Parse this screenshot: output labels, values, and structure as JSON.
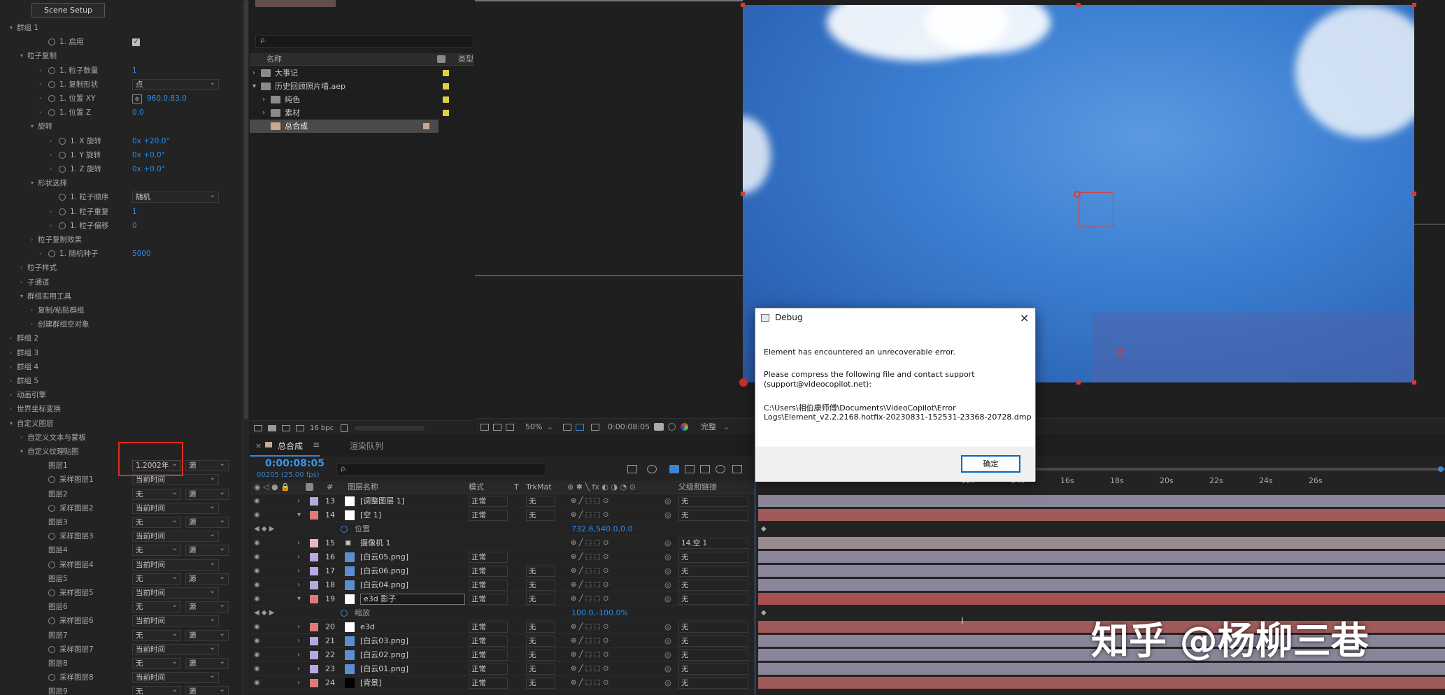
{
  "effect_panel": {
    "scene_setup": "Scene Setup",
    "rows": [
      {
        "t": "群组 1",
        "lv": 0,
        "arrow": "v"
      },
      {
        "t": "1. 启用",
        "lv": 3,
        "sw": 1,
        "chk": true
      },
      {
        "t": "粒子复制",
        "lv": 1,
        "arrow": "v"
      },
      {
        "t": "1. 粒子数量",
        "lv": 3,
        "sw": 1,
        "arrow": ">",
        "val": "1"
      },
      {
        "t": "1. 复制形状",
        "lv": 3,
        "sw": 1,
        "arrow": ">",
        "dd": "点"
      },
      {
        "t": "1. 位置 XY",
        "lv": 3,
        "sw": 1,
        "arrow": ">",
        "val": "960.0,83.0",
        "xy": true
      },
      {
        "t": "1. 位置 Z",
        "lv": 3,
        "sw": 1,
        "arrow": ">",
        "val": "0.0"
      },
      {
        "t": "旋转",
        "lv": 2,
        "arrow": "v"
      },
      {
        "t": "1. X 旋转",
        "lv": 4,
        "sw": 1,
        "arrow": ">",
        "val": "0x +20.0°"
      },
      {
        "t": "1. Y 旋转",
        "lv": 4,
        "sw": 1,
        "arrow": ">",
        "val": "0x +0.0°"
      },
      {
        "t": "1. Z 旋转",
        "lv": 4,
        "sw": 1,
        "arrow": ">",
        "val": "0x +0.0°"
      },
      {
        "t": "形状选择",
        "lv": 2,
        "arrow": "v"
      },
      {
        "t": "1. 粒子顺序",
        "lv": 4,
        "sw": 1,
        "dd": "随机"
      },
      {
        "t": "1. 粒子重复",
        "lv": 4,
        "sw": 1,
        "arrow": ">",
        "val": "1"
      },
      {
        "t": "1. 粒子偏移",
        "lv": 4,
        "sw": 1,
        "arrow": ">",
        "val": "0"
      },
      {
        "t": "粒子复制效果",
        "lv": 2,
        "arrow": ">"
      },
      {
        "t": "1. 随机种子",
        "lv": 3,
        "sw": 1,
        "arrow": ">",
        "val": "5000"
      },
      {
        "t": "粒子样式",
        "lv": 1,
        "arrow": ">"
      },
      {
        "t": "子通道",
        "lv": 1,
        "arrow": ">"
      },
      {
        "t": "群组实用工具",
        "lv": 1,
        "arrow": "v"
      },
      {
        "t": "复制/粘贴群组",
        "lv": 2,
        "arrow": ">"
      },
      {
        "t": "创建群组空对象",
        "lv": 2,
        "arrow": ">"
      },
      {
        "t": "群组 2",
        "lv": 0,
        "arrow": ">"
      },
      {
        "t": "群组 3",
        "lv": 0,
        "arrow": ">"
      },
      {
        "t": "群组 4",
        "lv": 0,
        "arrow": ">"
      },
      {
        "t": "群组 5",
        "lv": 0,
        "arrow": ">"
      },
      {
        "t": "动画引擎",
        "lv": 0,
        "arrow": ">"
      },
      {
        "t": "世界坐标变换",
        "lv": 0,
        "arrow": ">"
      },
      {
        "t": "自定义图层",
        "lv": 0,
        "arrow": "v"
      },
      {
        "t": "自定义文本与蒙板",
        "lv": 1,
        "arrow": ">"
      },
      {
        "t": "自定义纹理贴图",
        "lv": 1,
        "arrow": "v"
      },
      {
        "t": "图层1",
        "lv": 3,
        "dd": "1.2002年",
        "dd2": "源"
      },
      {
        "t": "采样图层1",
        "lv": 3,
        "sw": 1,
        "dd": "当前时间"
      },
      {
        "t": "图层2",
        "lv": 3,
        "dd": "无",
        "dd2": "源"
      },
      {
        "t": "采样图层2",
        "lv": 3,
        "sw": 1,
        "dd": "当前时间"
      },
      {
        "t": "图层3",
        "lv": 3,
        "dd": "无",
        "dd2": "源"
      },
      {
        "t": "采样图层3",
        "lv": 3,
        "sw": 1,
        "dd": "当前时间"
      },
      {
        "t": "图层4",
        "lv": 3,
        "dd": "无",
        "dd2": "源"
      },
      {
        "t": "采样图层4",
        "lv": 3,
        "sw": 1,
        "dd": "当前时间"
      },
      {
        "t": "图层5",
        "lv": 3,
        "dd": "无",
        "dd2": "源"
      },
      {
        "t": "采样图层5",
        "lv": 3,
        "sw": 1,
        "dd": "当前时间"
      },
      {
        "t": "图层6",
        "lv": 3,
        "dd": "无",
        "dd2": "源"
      },
      {
        "t": "采样图层6",
        "lv": 3,
        "sw": 1,
        "dd": "当前时间"
      },
      {
        "t": "图层7",
        "lv": 3,
        "dd": "无",
        "dd2": "源"
      },
      {
        "t": "采样图层7",
        "lv": 3,
        "sw": 1,
        "dd": "当前时间"
      },
      {
        "t": "图层8",
        "lv": 3,
        "dd": "无",
        "dd2": "源"
      },
      {
        "t": "采样图层8",
        "lv": 3,
        "sw": 1,
        "dd": "当前时间"
      },
      {
        "t": "图层9",
        "lv": 3,
        "dd": "无",
        "dd2": "源"
      }
    ]
  },
  "project": {
    "search_placeholder": "ρ.",
    "col_name": "名称",
    "col_type": "类型",
    "items": [
      {
        "name": "大事记",
        "folder": true,
        "arrow": ">",
        "color": "#e0d040",
        "lv": 0
      },
      {
        "name": "历史回顾照片墙.aep",
        "folder": true,
        "arrow": "v",
        "color": "#e0d040",
        "lv": 0
      },
      {
        "name": "纯色",
        "folder": true,
        "arrow": ">",
        "color": "#e0d040",
        "lv": 1
      },
      {
        "name": "素材",
        "folder": true,
        "arrow": ">",
        "color": "#e0d040",
        "lv": 1
      },
      {
        "name": "总合成",
        "folder": false,
        "arrow": "",
        "color": "#c8a890",
        "lv": 1,
        "selected": true
      }
    ],
    "bpc": "16 bpc"
  },
  "viewer": {
    "zoom": "50%",
    "timecode": "0:00:08:05",
    "quality": "完整"
  },
  "timeline": {
    "tab_comp": "总合成",
    "tab_render": "渲染队列",
    "current_time": "0:00:08:05",
    "frame_info": "00205 (25.00 fps)",
    "columns": {
      "num": "#",
      "name": "图层名称",
      "mode": "模式",
      "t": "T",
      "trkmat": "TrkMat",
      "parent": "父级和链接"
    },
    "ruler": [
      "12s",
      "14s",
      "16s",
      "18s",
      "20s",
      "22s",
      "24s",
      "26s"
    ],
    "layers": [
      {
        "num": "13",
        "name": "[调整图层 1]",
        "mode": "正常",
        "trk": "无",
        "parent": "无",
        "color": "#b8a8e0",
        "icon": "white",
        "bar": "#8a8598"
      },
      {
        "num": "14",
        "name": "[空 1]",
        "mode": "正常",
        "trk": "无",
        "parent": "无",
        "color": "#e07a7a",
        "icon": "white",
        "bar": "#a05a5a",
        "open": true
      },
      {
        "sub": true,
        "name": "位置",
        "value": "732.6,540.0,0.0"
      },
      {
        "num": "15",
        "name": "摄像机 1",
        "mode": "",
        "trk": "",
        "parent": "14.空 1",
        "color": "#e8b8c0",
        "icon": "cam",
        "bar": "#9a8a90"
      },
      {
        "num": "16",
        "name": "[白云05.png]",
        "mode": "正常",
        "trk": "",
        "parent": "无",
        "color": "#b8a8e0",
        "icon": "img",
        "bar": "#8a8598"
      },
      {
        "num": "17",
        "name": "[白云06.png]",
        "mode": "正常",
        "trk": "无",
        "parent": "无",
        "color": "#b8a8e0",
        "icon": "img",
        "bar": "#8a8598"
      },
      {
        "num": "18",
        "name": "[白云04.png]",
        "mode": "正常",
        "trk": "无",
        "parent": "无",
        "color": "#b8a8e0",
        "icon": "img",
        "bar": "#8a8598"
      },
      {
        "num": "19",
        "name": "e3d 影子",
        "mode": "正常",
        "trk": "无",
        "parent": "无",
        "color": "#e07a7a",
        "icon": "white",
        "bar": "#a85050",
        "open": true,
        "edit": true
      },
      {
        "sub": true,
        "name": "缩放",
        "value": "100.0,-100.0%"
      },
      {
        "num": "20",
        "name": "e3d",
        "mode": "正常",
        "trk": "无",
        "parent": "无",
        "color": "#e07a7a",
        "icon": "white",
        "bar": "#a05a5a"
      },
      {
        "num": "21",
        "name": "[白云03.png]",
        "mode": "正常",
        "trk": "无",
        "parent": "无",
        "color": "#b8a8e0",
        "icon": "img",
        "bar": "#8a8598"
      },
      {
        "num": "22",
        "name": "[白云02.png]",
        "mode": "正常",
        "trk": "无",
        "parent": "无",
        "color": "#b8a8e0",
        "icon": "img",
        "bar": "#8a8598"
      },
      {
        "num": "23",
        "name": "[白云01.png]",
        "mode": "正常",
        "trk": "无",
        "parent": "无",
        "color": "#b8a8e0",
        "icon": "img",
        "bar": "#8a8598"
      },
      {
        "num": "24",
        "name": "[背景]",
        "mode": "正常",
        "trk": "无",
        "parent": "无",
        "color": "#e07a7a",
        "icon": "black",
        "bar": "#a05a5a"
      }
    ]
  },
  "dialog": {
    "title": "Debug",
    "line1": "Element has encountered an unrecoverable error.",
    "line2": "Please compress the following file and contact support",
    "line3": "(support@videocopilot.net):",
    "line4": "C:\\Users\\相伯康师傅\\Documents\\VideoCopilot\\Error",
    "line5": "Logs\\Element_v2.2.2168.hotfix-20230831-152531-23368-20728.dmp",
    "ok": "确定"
  },
  "watermark": "知乎 @杨柳三巷"
}
